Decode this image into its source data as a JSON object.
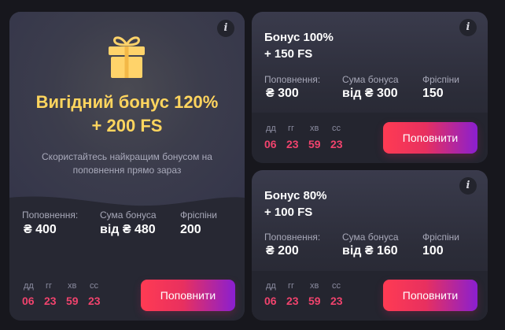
{
  "main_offer": {
    "title_line1": "Вигідний бонус 120%",
    "title_line2": "+ 200 FS",
    "description": "Скористайтесь найкращим бонусом на поповнення прямо зараз",
    "info": "i",
    "stats": {
      "deposit_label": "Поповнення:",
      "deposit_value": "₴ 400",
      "bonus_label": "Сума бонуса",
      "bonus_value": "від ₴ 480",
      "freespins_label": "Фріспіни",
      "freespins_value": "200"
    },
    "timer": {
      "days_label": "дд",
      "days": "06",
      "hours_label": "гг",
      "hours": "23",
      "minutes_label": "хв",
      "minutes": "59",
      "seconds_label": "сс",
      "seconds": "23"
    },
    "button_label": "Поповнити"
  },
  "offer_100": {
    "title_line1": "Бонус 100%",
    "title_line2": "+ 150 FS",
    "info": "i",
    "stats": {
      "deposit_label": "Поповнення:",
      "deposit_value": "₴ 300",
      "bonus_label": "Сума бонуса",
      "bonus_value": "від ₴ 300",
      "freespins_label": "Фріспіни",
      "freespins_value": "150"
    },
    "timer": {
      "days_label": "дд",
      "days": "06",
      "hours_label": "гг",
      "hours": "23",
      "minutes_label": "хв",
      "minutes": "59",
      "seconds_label": "сс",
      "seconds": "23"
    },
    "button_label": "Поповнити"
  },
  "offer_80": {
    "title_line1": "Бонус 80%",
    "title_line2": "+ 100 FS",
    "info": "i",
    "stats": {
      "deposit_label": "Поповнення:",
      "deposit_value": "₴ 200",
      "bonus_label": "Сума бонуса",
      "bonus_value": "від ₴ 160",
      "freespins_label": "Фріспіни",
      "freespins_value": "100"
    },
    "timer": {
      "days_label": "дд",
      "days": "06",
      "hours_label": "гг",
      "hours": "23",
      "minutes_label": "хв",
      "minutes": "59",
      "seconds_label": "сс",
      "seconds": "23"
    },
    "button_label": "Поповнити"
  },
  "colors": {
    "page_bg": "#17171d",
    "accent_gold": "#ffd55e",
    "timer_pink": "#f0436d",
    "button_gradient_start": "#ff3b53",
    "button_gradient_end": "#8a1fd0"
  },
  "icons": {
    "gift": "gift-icon",
    "info": "info-icon"
  }
}
